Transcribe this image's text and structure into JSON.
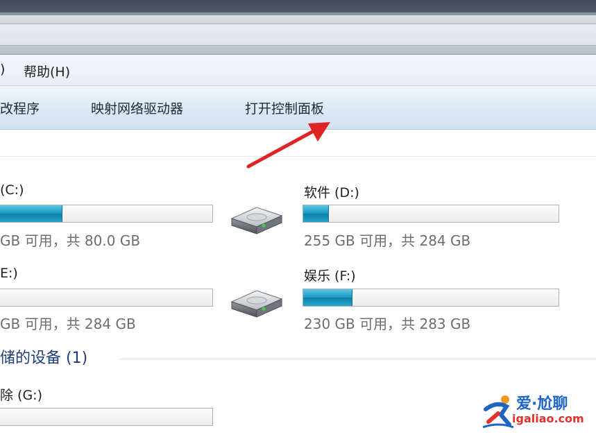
{
  "menubar": {
    "paren_fragment": ")",
    "help_label": "帮助(H)"
  },
  "commandbar": {
    "uninstall_fragment": "改程序",
    "map_drive_label": "映射网络驱动器",
    "open_control_panel_label": "打开控制面板"
  },
  "drives": [
    {
      "label": "(C:)",
      "info": "GB 可用，共 80.0 GB",
      "used_fraction": 0.28
    },
    {
      "label": "软件 (D:)",
      "info": "255 GB 可用，共 284 GB",
      "used_fraction": 0.1
    },
    {
      "label": "E:)",
      "info": "GB 可用，共 284 GB",
      "used_fraction": 0.0
    },
    {
      "label": "娱乐 (F:)",
      "info": "230 GB 可用，共 283 GB",
      "used_fraction": 0.19
    },
    {
      "label": "除 (G:)",
      "info": "",
      "used_fraction": 0.0
    }
  ],
  "removable_section": {
    "title": "储的设备 (1)"
  },
  "watermark": {
    "cn_text": "爱·尬聊",
    "url_text": "igaliao.com"
  },
  "colors": {
    "accent_fill": "#1b97c0",
    "section_title": "#1f3d7a",
    "arrow": "#e02424"
  },
  "icons": {
    "drive": "hard-drive-icon",
    "annotation": "red-arrow-icon"
  }
}
